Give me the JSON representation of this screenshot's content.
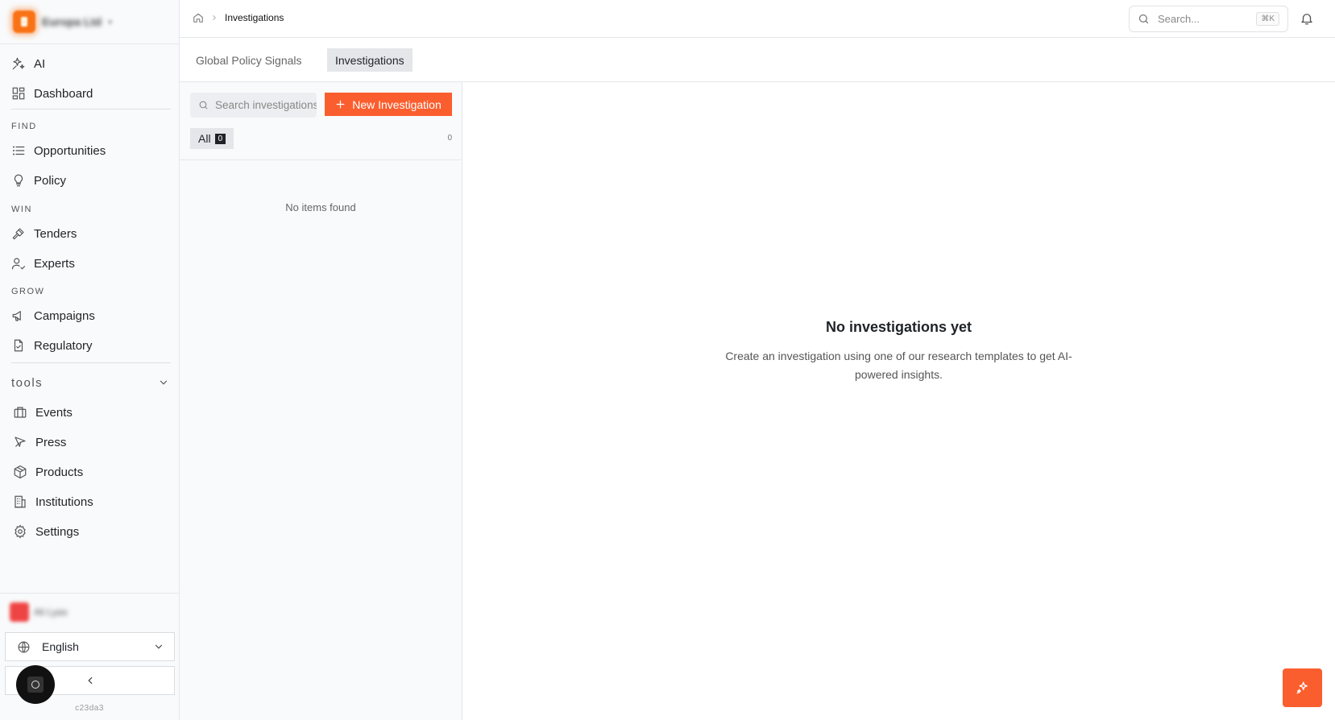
{
  "sidebar": {
    "brand_name": "Europa Ltd",
    "items_top": [
      {
        "label": "AI",
        "icon": "sparkles-icon"
      },
      {
        "label": "Dashboard",
        "icon": "dashboard-grid-icon"
      }
    ],
    "sections": {
      "find": "FIND",
      "win": "WIN",
      "grow": "GROW"
    },
    "find_items": [
      {
        "label": "Opportunities",
        "icon": "list-icon"
      },
      {
        "label": "Policy",
        "icon": "lightbulb-icon"
      }
    ],
    "win_items": [
      {
        "label": "Tenders",
        "icon": "gavel-icon"
      },
      {
        "label": "Experts",
        "icon": "user-check-icon"
      }
    ],
    "grow_items": [
      {
        "label": "Campaigns",
        "icon": "megaphone-icon"
      },
      {
        "label": "Regulatory",
        "icon": "document-check-icon"
      }
    ],
    "tools_label": "tools",
    "tools_items": [
      {
        "label": "Events",
        "icon": "calendar-box-icon"
      },
      {
        "label": "Press",
        "icon": "newspaper-icon"
      },
      {
        "label": "Products",
        "icon": "package-icon"
      },
      {
        "label": "Institutions",
        "icon": "building-icon"
      },
      {
        "label": "Settings",
        "icon": "gear-icon"
      }
    ],
    "user_name": "Ali Lyas",
    "language": "English",
    "version": "c23da3"
  },
  "topbar": {
    "breadcrumb_current": "Investigations",
    "search_placeholder": "Search...",
    "search_shortcut": "⌘K"
  },
  "tabs": [
    {
      "label": "Global Policy Signals",
      "active": false
    },
    {
      "label": "Investigations",
      "active": true
    }
  ],
  "list": {
    "search_placeholder": "Search investigations",
    "new_button_label": "New Investigation",
    "filter_all_label": "All",
    "filter_all_count": "0",
    "total_count": "0",
    "empty_text": "No items found"
  },
  "main": {
    "empty_title": "No investigations yet",
    "empty_description": "Create an investigation using one of our research templates to get AI-powered insights."
  },
  "colors": {
    "accent": "#fb5e2e",
    "sidebar_bg": "#f9fafb",
    "border": "#e5e7eb"
  }
}
